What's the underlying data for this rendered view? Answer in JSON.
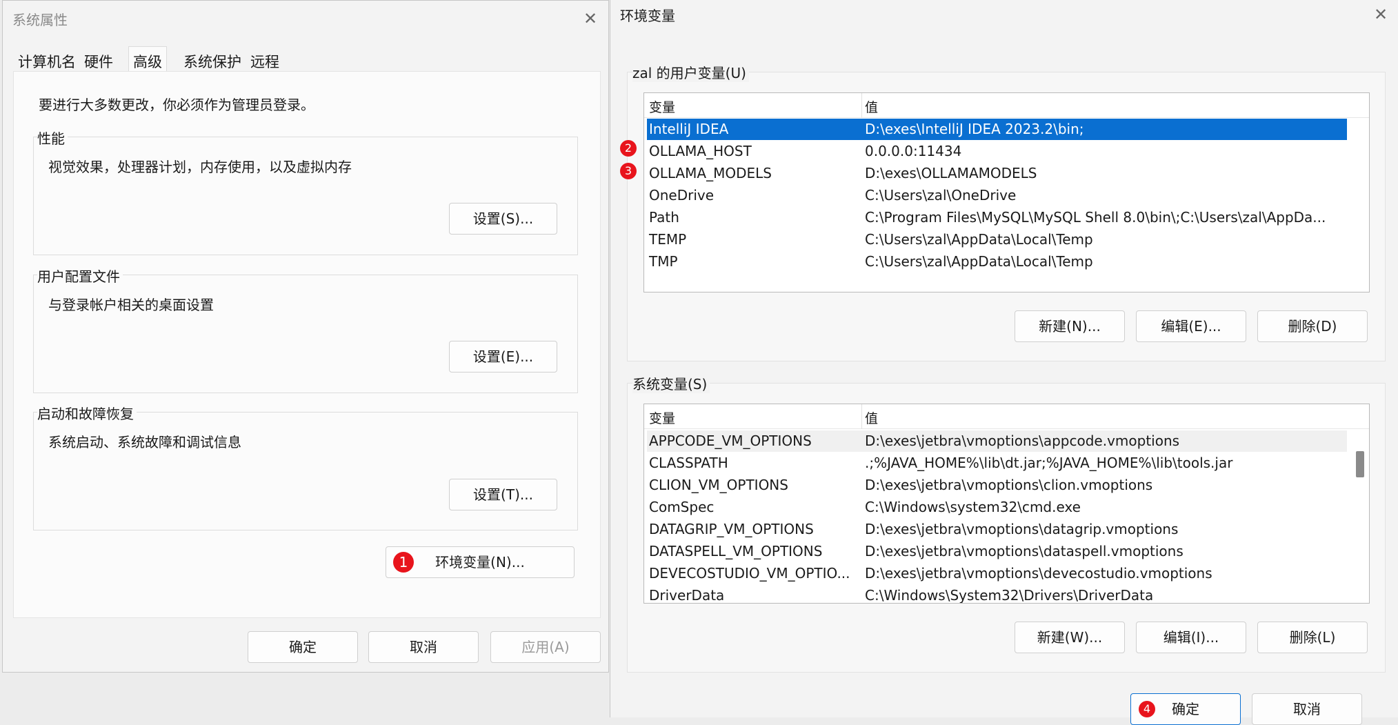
{
  "sysprop": {
    "title": "系统属性",
    "close_glyph": "✕",
    "tabs": [
      "计算机名",
      "硬件",
      "高级",
      "系统保护",
      "远程"
    ],
    "admin_note": "要进行大多数更改，你必须作为管理员登录。",
    "performance": {
      "label": "性能",
      "desc": "视觉效果，处理器计划，内存使用，以及虚拟内存",
      "button": "设置(S)..."
    },
    "user_profile": {
      "label": "用户配置文件",
      "desc": "与登录帐户相关的桌面设置",
      "button": "设置(E)..."
    },
    "startup": {
      "label": "启动和故障恢复",
      "desc": "系统启动、系统故障和调试信息",
      "button": "设置(T)..."
    },
    "env_button": "环境变量(N)...",
    "ok": "确定",
    "cancel": "取消",
    "apply": "应用(A)"
  },
  "env": {
    "title": "环境变量",
    "close_glyph": "✕",
    "user_section_label": "zal 的用户变量(U)",
    "col_var": "变量",
    "col_val": "值",
    "user_vars": [
      {
        "name": "IntelliJ IDEA",
        "value": "D:\\exes\\IntelliJ IDEA 2023.2\\bin;"
      },
      {
        "name": "OLLAMA_HOST",
        "value": "0.0.0.0:11434"
      },
      {
        "name": "OLLAMA_MODELS",
        "value": "D:\\exes\\OLLAMAMODELS"
      },
      {
        "name": "OneDrive",
        "value": "C:\\Users\\zal\\OneDrive"
      },
      {
        "name": "Path",
        "value": "C:\\Program Files\\MySQL\\MySQL Shell 8.0\\bin\\;C:\\Users\\zal\\AppDa..."
      },
      {
        "name": "TEMP",
        "value": "C:\\Users\\zal\\AppData\\Local\\Temp"
      },
      {
        "name": "TMP",
        "value": "C:\\Users\\zal\\AppData\\Local\\Temp"
      }
    ],
    "user_buttons": {
      "new": "新建(N)...",
      "edit": "编辑(E)...",
      "delete": "删除(D)"
    },
    "system_section_label": "系统变量(S)",
    "system_vars": [
      {
        "name": "APPCODE_VM_OPTIONS",
        "value": "D:\\exes\\jetbra\\vmoptions\\appcode.vmoptions"
      },
      {
        "name": "CLASSPATH",
        "value": ".;%JAVA_HOME%\\lib\\dt.jar;%JAVA_HOME%\\lib\\tools.jar"
      },
      {
        "name": "CLION_VM_OPTIONS",
        "value": "D:\\exes\\jetbra\\vmoptions\\clion.vmoptions"
      },
      {
        "name": "ComSpec",
        "value": "C:\\Windows\\system32\\cmd.exe"
      },
      {
        "name": "DATAGRIP_VM_OPTIONS",
        "value": "D:\\exes\\jetbra\\vmoptions\\datagrip.vmoptions"
      },
      {
        "name": "DATASPELL_VM_OPTIONS",
        "value": "D:\\exes\\jetbra\\vmoptions\\dataspell.vmoptions"
      },
      {
        "name": "DEVECOSTUDIO_VM_OPTIO...",
        "value": "D:\\exes\\jetbra\\vmoptions\\devecostudio.vmoptions"
      },
      {
        "name": "DriverData",
        "value": "C:\\Windows\\System32\\Drivers\\DriverData"
      }
    ],
    "system_buttons": {
      "new": "新建(W)...",
      "edit": "编辑(I)...",
      "delete": "删除(L)"
    },
    "ok": "确定",
    "cancel": "取消"
  },
  "annotations": [
    "1",
    "2",
    "3",
    "4"
  ],
  "colors": {
    "selection": "#0a6fd1",
    "badge": "#e8141c"
  }
}
